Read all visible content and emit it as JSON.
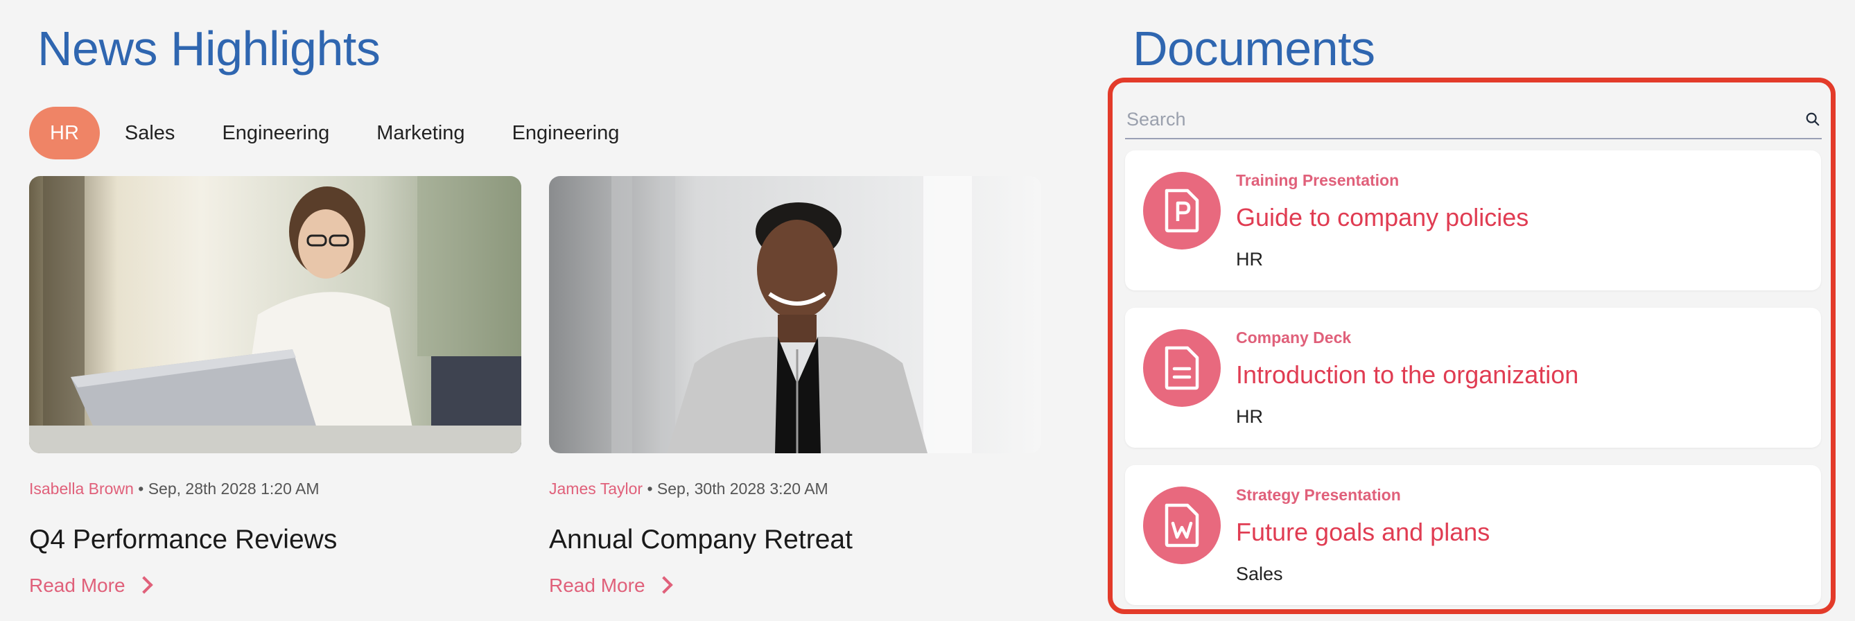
{
  "news": {
    "title": "News Highlights",
    "tabs": [
      {
        "label": "HR",
        "active": true
      },
      {
        "label": "Sales",
        "active": false
      },
      {
        "label": "Engineering",
        "active": false
      },
      {
        "label": "Marketing",
        "active": false
      },
      {
        "label": "Engineering",
        "active": false
      }
    ],
    "articles": [
      {
        "author": "Isabella Brown",
        "date": "• Sep, 28th 2028 1:20 AM",
        "headline": "Q4 Performance Reviews",
        "read_more": "Read More"
      },
      {
        "author": "James Taylor",
        "date": "• Sep, 30th 2028 3:20 AM",
        "headline": "Annual Company Retreat",
        "read_more": "Read More"
      }
    ]
  },
  "documents": {
    "title": "Documents",
    "search": {
      "placeholder": "Search",
      "value": ""
    },
    "items": [
      {
        "icon": "powerpoint-file-icon",
        "category": "Training Presentation",
        "title": "Guide to company policies",
        "department": "HR"
      },
      {
        "icon": "document-file-icon",
        "category": "Company Deck",
        "title": "Introduction to the organization",
        "department": "HR"
      },
      {
        "icon": "word-file-icon",
        "category": "Strategy Presentation",
        "title": "Future goals and plans",
        "department": "Sales"
      }
    ]
  },
  "colors": {
    "heading_blue": "#2f66b0",
    "tab_active": "#ef8466",
    "accent_pink": "#e0607a",
    "doc_title_red": "#e03c52",
    "panel_border": "#e33b2a",
    "icon_circle": "#e8697e"
  }
}
